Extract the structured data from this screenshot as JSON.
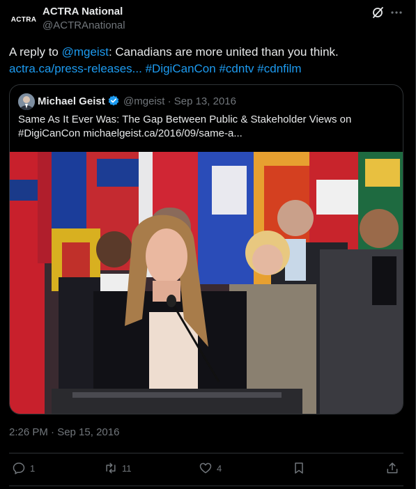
{
  "author": {
    "name": "ACTRA National",
    "handle": "@ACTRAnational",
    "avatar_text": "ACTRA"
  },
  "tweet": {
    "reply_prefix": "A reply to ",
    "mention": "@mgeist",
    "text": ": Canadians are more united than you think.",
    "link": "actra.ca/press-releases...",
    "hashtags": [
      "#DigiCanCon",
      "#cdntv",
      "#cdnfilm"
    ]
  },
  "quote": {
    "name": "Michael Geist",
    "meta": "@mgeist · Sep 13, 2016",
    "text": "Same As It Ever Was: The Gap Between Public & Stakeholder Views on #DigiCanCon michaelgeist.ca/2016/09/same-a..."
  },
  "timestamp": "2:26 PM · Sep 15, 2016",
  "actions": {
    "replies": "1",
    "reposts": "11",
    "likes": "4"
  },
  "colors": {
    "background": "#000000",
    "text": "#e7e9ea",
    "muted": "#71767b",
    "link": "#1d9bf0",
    "border": "#2f3336"
  },
  "icons": [
    "grok-icon",
    "more-icon",
    "verified-icon",
    "reply-icon",
    "repost-icon",
    "like-icon",
    "bookmark-icon",
    "share-icon"
  ]
}
